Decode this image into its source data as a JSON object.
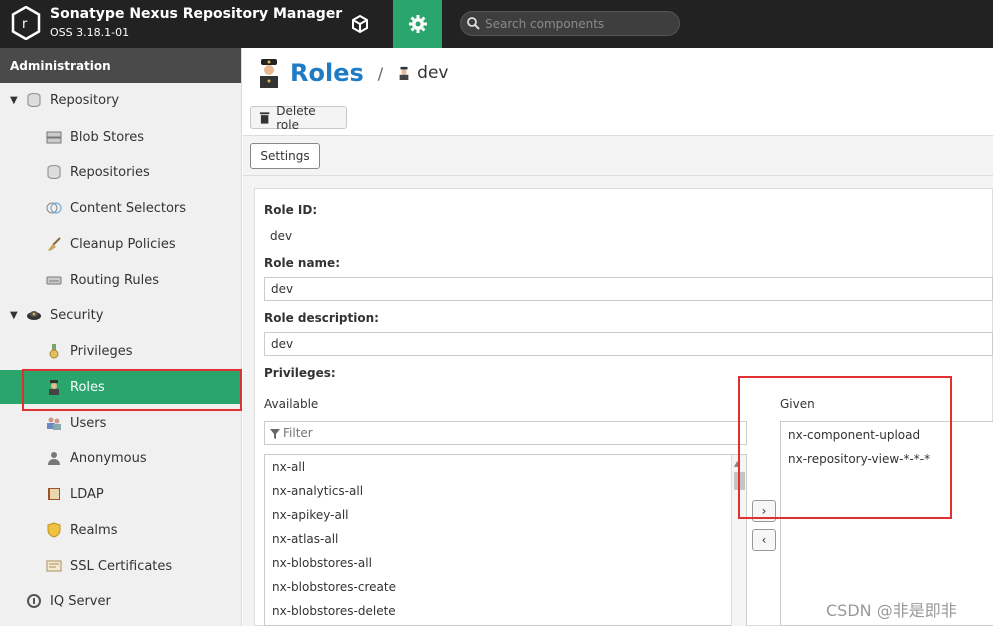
{
  "header": {
    "app_title": "Sonatype Nexus Repository Manager",
    "version": "OSS 3.18.1-01",
    "search_placeholder": "Search components",
    "colors": {
      "topbar": "#222222",
      "accent": "#2aa56c"
    }
  },
  "sidebar": {
    "title": "Administration",
    "items": [
      {
        "label": "Repository",
        "icon": "database-icon",
        "group": true
      },
      {
        "label": "Blob Stores",
        "icon": "server-icon"
      },
      {
        "label": "Repositories",
        "icon": "database-icon"
      },
      {
        "label": "Content Selectors",
        "icon": "selector-icon"
      },
      {
        "label": "Cleanup Policies",
        "icon": "broom-icon"
      },
      {
        "label": "Routing Rules",
        "icon": "routing-icon"
      },
      {
        "label": "Security",
        "icon": "police-hat-icon",
        "group": true
      },
      {
        "label": "Privileges",
        "icon": "medal-icon"
      },
      {
        "label": "Roles",
        "icon": "officer-icon",
        "selected": true
      },
      {
        "label": "Users",
        "icon": "users-icon"
      },
      {
        "label": "Anonymous",
        "icon": "anonymous-user-icon"
      },
      {
        "label": "LDAP",
        "icon": "book-icon"
      },
      {
        "label": "Realms",
        "icon": "shield-icon"
      },
      {
        "label": "SSL Certificates",
        "icon": "certificate-icon"
      },
      {
        "label": "IQ Server",
        "icon": "iq-icon"
      }
    ]
  },
  "breadcrumb": {
    "title": "Roles",
    "separator": "/",
    "current": "dev"
  },
  "toolbar": {
    "delete_label": "Delete role"
  },
  "tabs": {
    "settings_label": "Settings"
  },
  "form": {
    "role_id_label": "Role ID:",
    "role_id_value": "dev",
    "role_name_label": "Role name:",
    "role_name_value": "dev",
    "role_desc_label": "Role description:",
    "role_desc_value": "dev",
    "privileges_label": "Privileges:",
    "available_label": "Available",
    "given_label": "Given",
    "filter_placeholder": "Filter",
    "available_items": [
      "nx-all",
      "nx-analytics-all",
      "nx-apikey-all",
      "nx-atlas-all",
      "nx-blobstores-all",
      "nx-blobstores-create",
      "nx-blobstores-delete"
    ],
    "given_items": [
      "nx-component-upload",
      "nx-repository-view-*-*-*"
    ],
    "move_right": "›",
    "move_left": "‹"
  },
  "watermark": "CSDN @非是即非"
}
